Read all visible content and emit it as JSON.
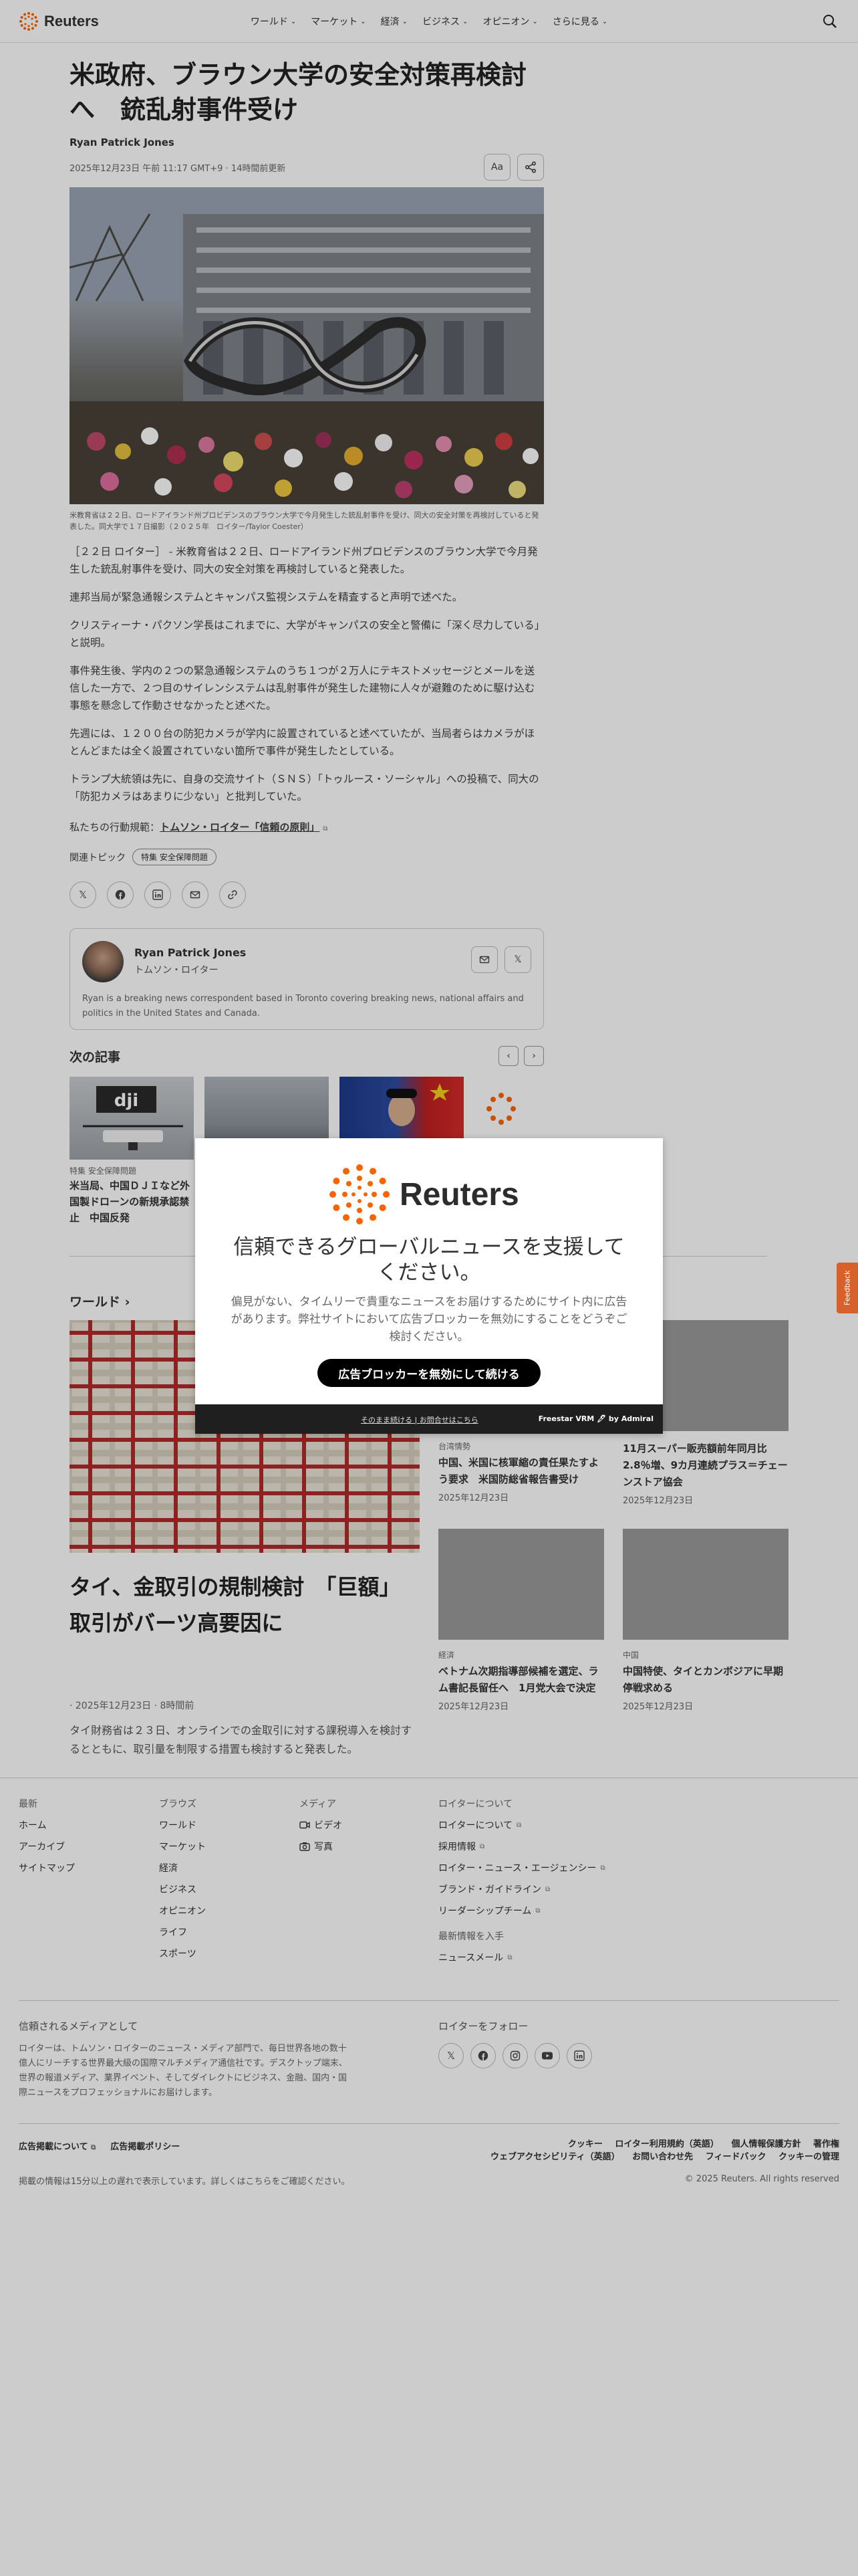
{
  "header": {
    "brand": "Reuters",
    "nav": [
      "ワールド",
      "マーケット",
      "経済",
      "ビジネス",
      "オピニオン",
      "さらに見る"
    ]
  },
  "article": {
    "headline": "米政府、ブラウン大学の安全対策再検討へ　銃乱射事件受け",
    "author": "Ryan Patrick Jones",
    "date": "2025年12月23日 午前 11:17 GMT+9 · 14時間前更新",
    "text_size_button": "Aa",
    "caption": "米教育省は２２日、ロードアイランド州プロビデンスのブラウン大学で今月発生した銃乱射事件を受け、同大の安全対策を再検討していると発表した。同大学で１７日撮影（２０２５年　ロイター/Taylor Coester）",
    "paragraphs": [
      "［２２日 ロイター］ - 米教育省は２２日、ロードアイランド州プロビデンスのブラウン大学で今月発生した銃乱射事件を受け、同大の安全対策を再検討していると発表した。",
      "連邦当局が緊急通報システムとキャンパス監視システムを精査すると声明で述べた。",
      "クリスティーナ・パクソン学長はこれまでに、大学がキャンパスの安全と警備に「深く尽力している」と説明。",
      "事件発生後、学内の２つの緊急通報システムのうち１つが２万人にテキストメッセージとメールを送信した一方で、２つ目のサイレンシステムは乱射事件が発生した建物に人々が避難のために駆け込む事態を懸念して作動させなかったと述べた。",
      "先週には、１２００台の防犯カメラが学内に設置されていると述べていたが、当局者らはカメラがほとんどまたは全く設置されていない箇所で事件が発生したとしている。",
      "トランプ大統領は先に、自身の交流サイト（ＳＮＳ）「トゥルース・ソーシャル」への投稿で、同大の「防犯カメラはあまりに少ない」と批判していた。"
    ],
    "standards_prefix": "私たちの行動規範：",
    "standards_link": "トムソン・ロイター「信頼の原則」",
    "topics_label": "関連トピック",
    "topic_pill": "特集 安全保障問題"
  },
  "author_box": {
    "name": "Ryan Patrick Jones",
    "role": "トムソン・ロイター",
    "bio": "Ryan is a breaking news correspondent based in Toronto covering breaking news, national affairs and politics in the United States and Canada."
  },
  "next": {
    "title": "次の記事",
    "cards": [
      {
        "kicker": "特集 安全保障問題",
        "title": "米当局、中国ＤＪＩなど外国製ドローンの新規承認禁止　中国反発"
      },
      {
        "kicker": "",
        "title": ""
      },
      {
        "kicker": "",
        "title": ""
      },
      {
        "kicker": "",
        "title": ""
      }
    ]
  },
  "world": {
    "title": "ワールド",
    "lead": {
      "title": "タイ、金取引の規制検討　「巨額」取引がバーツ高要因に",
      "time": "· 2025年12月23日 · 8時間前",
      "desc": "タイ財務省は２３日、オンラインでの金取引に対する課税導入を検討するとともに、取引量を制限する措置も検討すると発表した。"
    },
    "cards": [
      {
        "kicker": "台湾情勢",
        "title": "中国、米国に核軍縮の責任果たすよう要求　米国防総省報告書受け",
        "date": "2025年12月23日"
      },
      {
        "kicker": "",
        "title": "11月スーパー販売額前年同月比2.8％増、9カ月連続プラス＝チェーンストア協会",
        "date": "2025年12月23日"
      },
      {
        "kicker": "経済",
        "title": "ベトナム次期指導部候補を選定、ラム書記長留任へ　1月党大会で決定",
        "date": "2025年12月23日"
      },
      {
        "kicker": "中国",
        "title": "中国特使、タイとカンボジアに早期停戦求める",
        "date": "2025年12月23日"
      }
    ]
  },
  "footer": {
    "col1": {
      "heading": "最新",
      "items": [
        "ホーム",
        "アーカイブ",
        "サイトマップ"
      ]
    },
    "col2": {
      "heading": "ブラウズ",
      "items": [
        "ワールド",
        "マーケット",
        "経済",
        "ビジネス",
        "オピニオン",
        "ライフ",
        "スポーツ"
      ]
    },
    "col3": {
      "heading": "メディア",
      "items": [
        "ビデオ",
        "写真"
      ]
    },
    "col4": {
      "heading": "ロイターについて",
      "items": [
        "ロイターについて",
        "採用情報",
        "ロイター・ニュース・エージェンシー",
        "ブランド・ガイドライン",
        "リーダーシップチーム"
      ]
    },
    "newsletter_heading": "最新情報を入手",
    "newsletter": "ニュースメール",
    "trust_heading": "信頼されるメディアとして",
    "trust_text": "ロイターは、トムソン・ロイターのニュース・メディア部門で、毎日世界各地の数十億人にリーチする世界最大級の国際マルチメディア通信社です。デスクトップ端末、世界の報道メディア、業界イベント、そしてダイレクトにビジネス、金融、国内・国際ニュースをプロフェッショナルにお届けします。",
    "follow_heading": "ロイターをフォロー",
    "ad_links": [
      "広告掲載について",
      "広告掲載ポリシー"
    ],
    "legal_links": [
      "クッキー",
      "ロイター利用規約（英語）",
      "個人情報保護方針",
      "著作権",
      "ウェブアクセシビリティ（英語）",
      "お問い合わせ先",
      "フィードバック",
      "クッキーの管理"
    ],
    "delay": "掲載の情報は15分以上の遅れで表示しています。詳しくはこちらをご確認ください。",
    "copyright": "© 2025 Reuters. All rights reserved"
  },
  "modal": {
    "brand": "Reuters",
    "heading": "信頼できるグローバルニュースを支援してください。",
    "text": "偏見がない、タイムリーで貴重なニュースをお届けするためにサイト内に広告があります。弊社サイトにおいて広告ブロッカーを無効にすることをどうぞご検討ください。",
    "button": "広告ブロッカーを無効にして続ける",
    "link_continue": "そのまま続ける",
    "link_contact": "お問合せはこちら",
    "powered": "Freestar VRM 🖊 by Admiral"
  },
  "feedback": "Feedback"
}
